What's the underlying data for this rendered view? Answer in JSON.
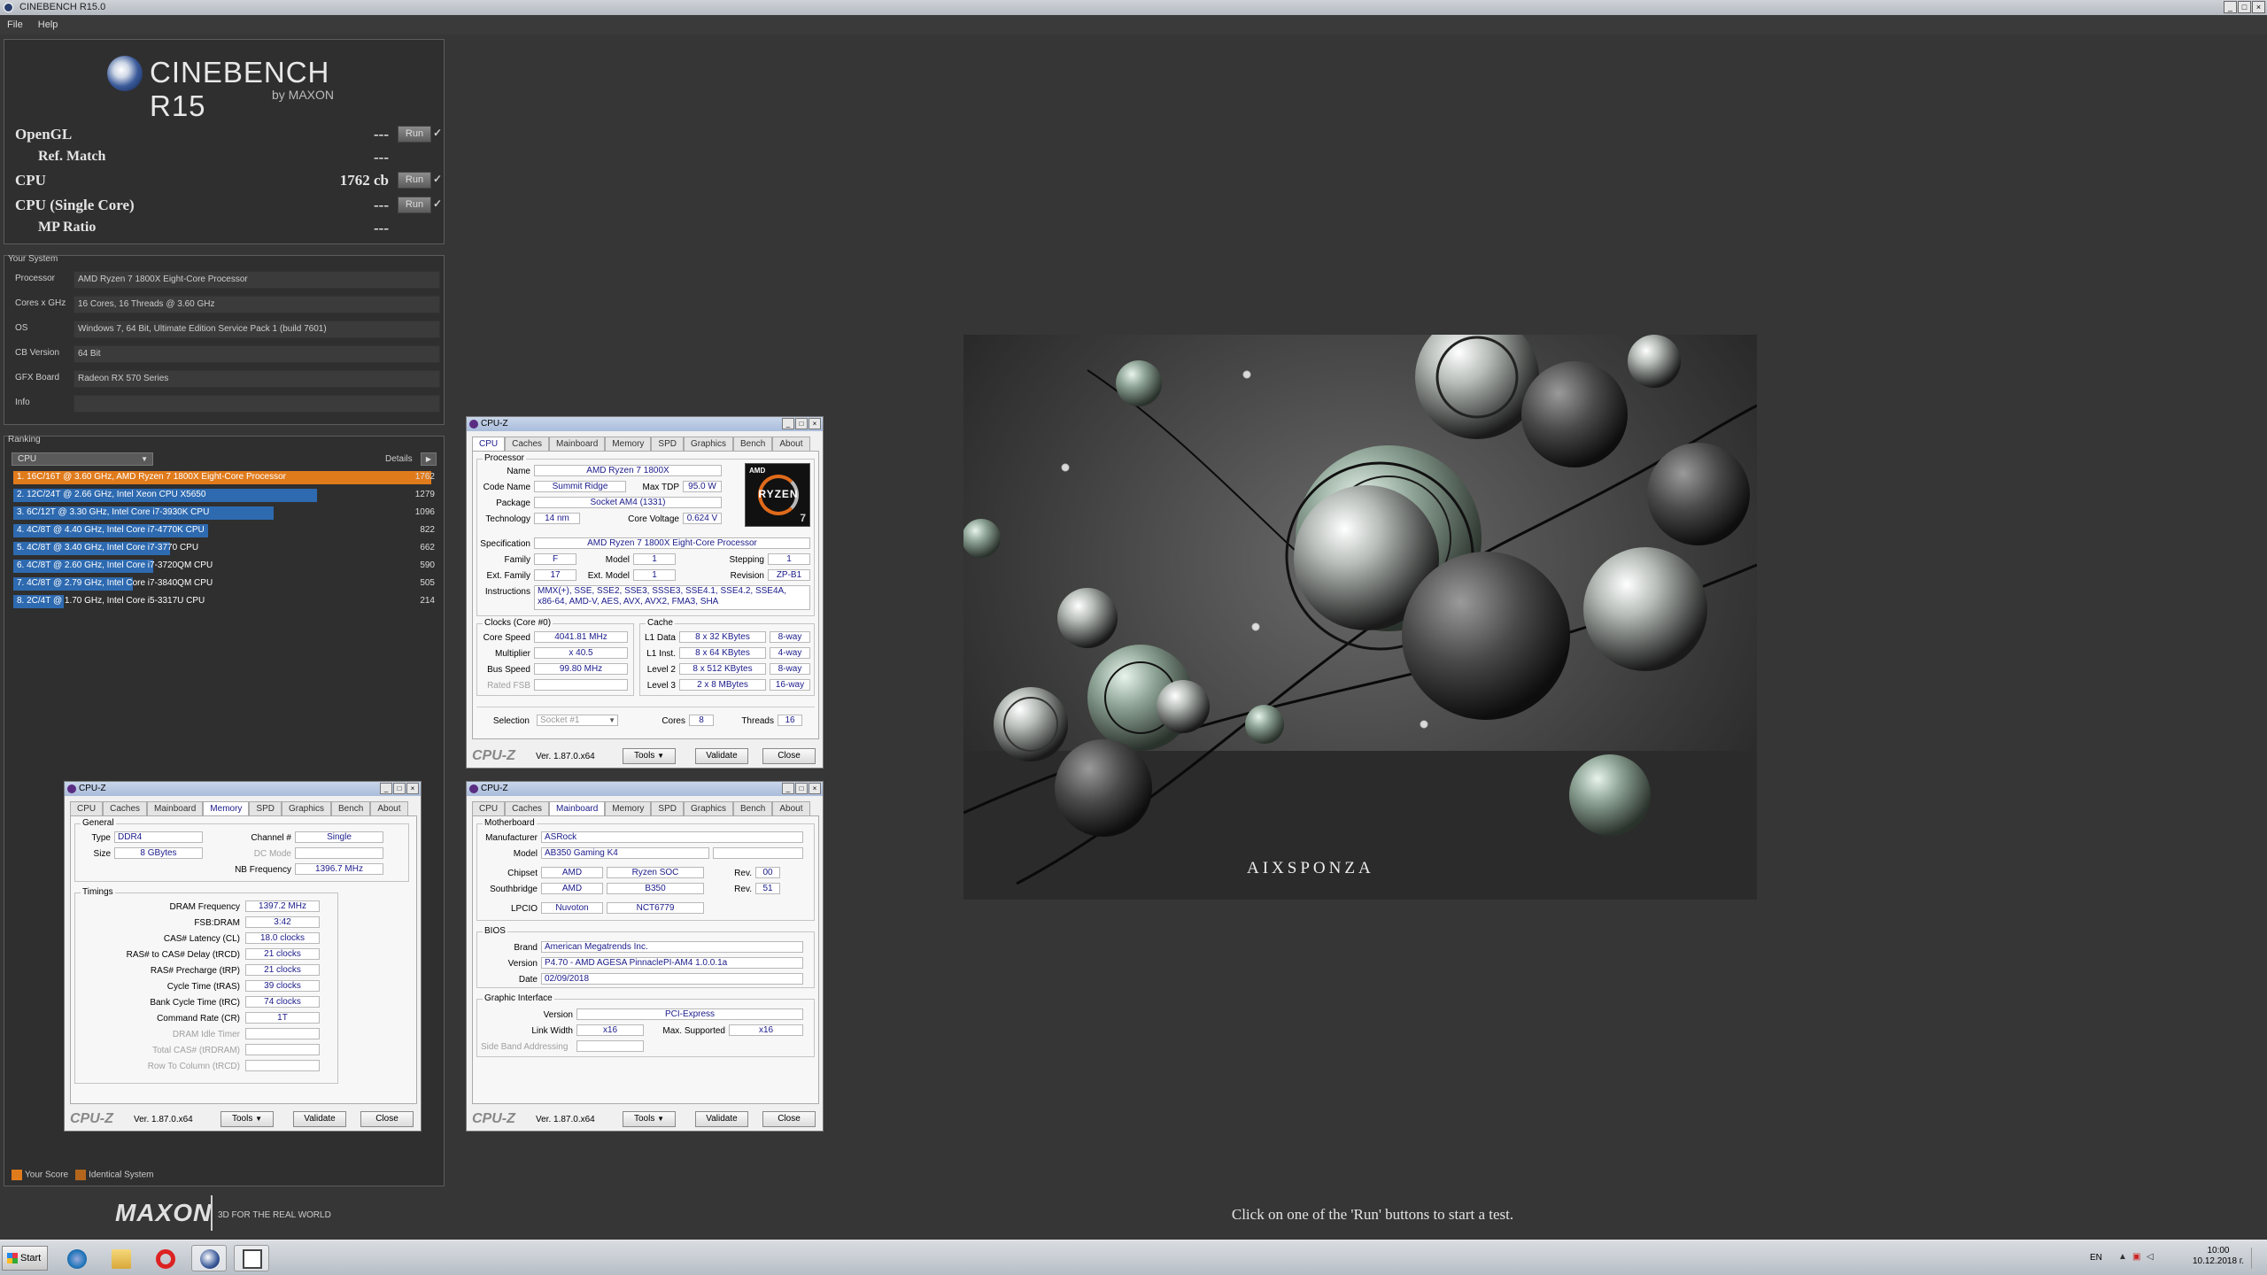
{
  "window": {
    "title": "CINEBENCH R15.0",
    "controls": [
      "_",
      "□",
      "×"
    ]
  },
  "menu": [
    "File",
    "Help"
  ],
  "brand": {
    "name": "CINEBENCH R15",
    "by": "by MAXON"
  },
  "tests": [
    {
      "label": "OpenGL",
      "value": "---",
      "run": "Run",
      "check": "✓"
    },
    {
      "label": "Ref. Match",
      "value": "---"
    },
    {
      "label": "CPU",
      "value": "1762 cb",
      "run": "Run",
      "check": "✓"
    },
    {
      "label": "CPU (Single Core)",
      "value": "---",
      "run": "Run",
      "check": "✓"
    },
    {
      "label": "MP Ratio",
      "value": "---"
    }
  ],
  "system": {
    "section": "Your System",
    "rows": [
      {
        "key": "Processor",
        "value": "AMD Ryzen 7 1800X Eight-Core Processor"
      },
      {
        "key": "Cores x GHz",
        "value": "16 Cores, 16 Threads @ 3.60 GHz"
      },
      {
        "key": "OS",
        "value": "Windows 7, 64 Bit, Ultimate Edition Service Pack 1 (build 7601)"
      },
      {
        "key": "CB Version",
        "value": "64 Bit"
      },
      {
        "key": "GFX Board",
        "value": "Radeon RX 570 Series"
      },
      {
        "key": "Info",
        "value": ""
      }
    ]
  },
  "ranking": {
    "section": "Ranking",
    "select": "CPU",
    "details": "Details",
    "max_score": 1762,
    "rows": [
      {
        "label": "1. 16C/16T @ 3.60 GHz, AMD Ryzen 7 1800X Eight-Core Processor",
        "score": 1762,
        "color": "#e07b1c"
      },
      {
        "label": "2. 12C/24T @ 2.66 GHz, Intel Xeon CPU X5650",
        "score": 1279,
        "color": "#2e6ab0"
      },
      {
        "label": "3. 6C/12T @ 3.30 GHz,  Intel Core i7-3930K CPU",
        "score": 1096,
        "color": "#2e6ab0"
      },
      {
        "label": "4. 4C/8T @ 4.40 GHz, Intel Core i7-4770K CPU",
        "score": 822,
        "color": "#2e6ab0"
      },
      {
        "label": "5. 4C/8T @ 3.40 GHz,  Intel Core i7-3770 CPU",
        "score": 662,
        "color": "#2e6ab0"
      },
      {
        "label": "6. 4C/8T @ 2.60 GHz, Intel Core i7-3720QM CPU",
        "score": 590,
        "color": "#2e6ab0"
      },
      {
        "label": "7. 4C/8T @ 2.79 GHz,  Intel Core i7-3840QM CPU",
        "score": 505,
        "color": "#2e6ab0"
      },
      {
        "label": "8. 2C/4T @ 1.70 GHz,  Intel Core i5-3317U CPU",
        "score": 214,
        "color": "#2e6ab0"
      }
    ],
    "legend": [
      {
        "label": "Your Score",
        "color": "#e07b1c"
      },
      {
        "label": "Identical System",
        "color": "#b3661c"
      }
    ]
  },
  "footer": {
    "maxon": "MAXON",
    "slogan": "3D FOR THE REAL WORLD",
    "hint": "Click on one of the 'Run' buttons to start a test."
  },
  "render": {
    "watermark": "AIXSPONZA"
  },
  "cpuz_common": {
    "title": "CPU-Z",
    "tabs": [
      "CPU",
      "Caches",
      "Mainboard",
      "Memory",
      "SPD",
      "Graphics",
      "Bench",
      "About"
    ],
    "brand": "CPU-Z",
    "version": "Ver. 1.87.0.x64",
    "tools": "Tools",
    "validate": "Validate",
    "close": "Close"
  },
  "cpuz_cpu": {
    "processor_group": "Processor",
    "name_label": "Name",
    "name": "AMD Ryzen 7 1800X",
    "codename_label": "Code Name",
    "codename": "Summit Ridge",
    "maxtdp_label": "Max TDP",
    "maxtdp": "95.0 W",
    "package_label": "Package",
    "package": "Socket AM4 (1331)",
    "tech_label": "Technology",
    "tech": "14 nm",
    "voltage_label": "Core Voltage",
    "voltage": "0.624 V",
    "spec_label": "Specification",
    "spec": "AMD Ryzen 7 1800X Eight-Core Processor",
    "family_label": "Family",
    "family": "F",
    "model_label": "Model",
    "model": "1",
    "stepping_label": "Stepping",
    "stepping": "1",
    "extfamily_label": "Ext. Family",
    "extfamily": "17",
    "extmodel_label": "Ext. Model",
    "extmodel": "1",
    "revision_label": "Revision",
    "revision": "ZP-B1",
    "instr_label": "Instructions",
    "instr1": "MMX(+), SSE, SSE2, SSE3, SSSE3, SSE4.1, SSE4.2, SSE4A,",
    "instr2": "x86-64, AMD-V, AES, AVX, AVX2, FMA3, SHA",
    "clocks_group": "Clocks (Core #0)",
    "corespeed_label": "Core Speed",
    "corespeed": "4041.81 MHz",
    "mult_label": "Multiplier",
    "mult": "x 40.5",
    "bus_label": "Bus Speed",
    "bus": "99.80 MHz",
    "fsb_label": "Rated FSB",
    "fsb": "",
    "cache_group": "Cache",
    "l1d_label": "L1 Data",
    "l1d": "8 x 32 KBytes",
    "l1d_way": "8-way",
    "l1i_label": "L1 Inst.",
    "l1i": "8 x 64 KBytes",
    "l1i_way": "4-way",
    "l2_label": "Level 2",
    "l2": "8 x 512 KBytes",
    "l2_way": "8-way",
    "l3_label": "Level 3",
    "l3": "2 x 8 MBytes",
    "l3_way": "16-way",
    "selection_label": "Selection",
    "selection": "Socket #1",
    "cores_label": "Cores",
    "cores": "8",
    "threads_label": "Threads",
    "threads": "16",
    "logo": {
      "amd": "AMD",
      "ryzen": "RYZEN",
      "num": "7"
    }
  },
  "cpuz_mb": {
    "mb_group": "Motherboard",
    "manu_label": "Manufacturer",
    "manu": "ASRock",
    "model_label": "Model",
    "model": "AB350 Gaming K4",
    "chipset_label": "Chipset",
    "chipset": "AMD",
    "chipset2": "Ryzen SOC",
    "rev_label": "Rev.",
    "chipset_rev": "00",
    "south_label": "Southbridge",
    "south": "AMD",
    "south2": "B350",
    "south_rev": "51",
    "lpcio_label": "LPCIO",
    "lpcio": "Nuvoton",
    "lpcio2": "NCT6779",
    "bios_group": "BIOS",
    "brand_label": "Brand",
    "brand": "American Megatrends Inc.",
    "version_label": "Version",
    "version": "P4.70 - AMD AGESA PinnaclePI-AM4 1.0.0.1a",
    "date_label": "Date",
    "date": "02/09/2018",
    "gi_group": "Graphic Interface",
    "gi_version_label": "Version",
    "gi_version": "PCI-Express",
    "lw_label": "Link Width",
    "lw": "x16",
    "maxsup_label": "Max. Supported",
    "maxsup": "x16",
    "sba_label": "Side Band Addressing"
  },
  "cpuz_mem": {
    "general_group": "General",
    "type_label": "Type",
    "type": "DDR4",
    "channel_label": "Channel #",
    "channel": "Single",
    "size_label": "Size",
    "size": "8 GBytes",
    "dcmode_label": "DC Mode",
    "nbfreq_label": "NB Frequency",
    "nbfreq": "1396.7 MHz",
    "timings_group": "Timings",
    "rows": [
      {
        "label": "DRAM Frequency",
        "value": "1397.2 MHz",
        "dim": false
      },
      {
        "label": "FSB:DRAM",
        "value": "3:42",
        "dim": false
      },
      {
        "label": "CAS# Latency (CL)",
        "value": "18.0 clocks",
        "dim": false
      },
      {
        "label": "RAS# to CAS# Delay (tRCD)",
        "value": "21 clocks",
        "dim": false
      },
      {
        "label": "RAS# Precharge (tRP)",
        "value": "21 clocks",
        "dim": false
      },
      {
        "label": "Cycle Time (tRAS)",
        "value": "39 clocks",
        "dim": false
      },
      {
        "label": "Bank Cycle Time (tRC)",
        "value": "74 clocks",
        "dim": false
      },
      {
        "label": "Command Rate (CR)",
        "value": "1T",
        "dim": false
      },
      {
        "label": "DRAM Idle Timer",
        "value": "",
        "dim": true
      },
      {
        "label": "Total CAS# (tRDRAM)",
        "value": "",
        "dim": true
      },
      {
        "label": "Row To Column (tRCD)",
        "value": "",
        "dim": true
      }
    ]
  },
  "taskbar": {
    "start": "Start",
    "lang": "EN",
    "time": "10:00",
    "date": "10.12.2018 г."
  }
}
